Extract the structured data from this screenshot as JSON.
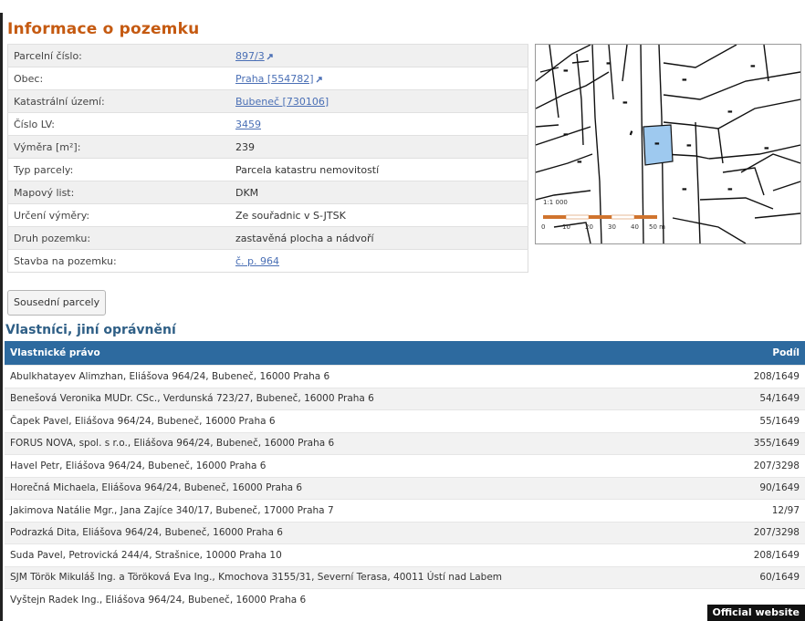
{
  "parcel_info": {
    "title": "Informace o pozemku",
    "rows": [
      {
        "label": "Parcelní číslo:",
        "value": "897/3",
        "link": true,
        "ext": true
      },
      {
        "label": "Obec:",
        "value": "Praha [554782]",
        "link": true,
        "ext": true
      },
      {
        "label": "Katastrální území:",
        "value": "Bubeneč [730106]",
        "link": true,
        "ext": false
      },
      {
        "label": "Číslo LV:",
        "value": "3459",
        "link": true,
        "ext": false
      },
      {
        "label": "Výměra [m²]:",
        "value": "239",
        "link": false,
        "ext": false
      },
      {
        "label": "Typ parcely:",
        "value": "Parcela katastru nemovitostí",
        "link": false,
        "ext": false
      },
      {
        "label": "Mapový list:",
        "value": "DKM",
        "link": false,
        "ext": false
      },
      {
        "label": "Určení výměry:",
        "value": "Ze souřadnic v S-JTSK",
        "link": false,
        "ext": false
      },
      {
        "label": "Druh pozemku:",
        "value": "zastavěná plocha a nádvoří",
        "link": false,
        "ext": false
      },
      {
        "label": "Stavba na pozemku:",
        "value": "č. p. 964",
        "link": true,
        "ext": false
      }
    ]
  },
  "map": {
    "scale_label": "1:1 000",
    "scale_ticks": [
      "0",
      "10",
      "20",
      "30",
      "40",
      "50 m"
    ],
    "highlight_color": "#9ec9ef"
  },
  "neighbors_button": "Sousední parcely",
  "owners": {
    "title": "Vlastníci, jiní oprávnění",
    "header": {
      "name": "Vlastnické právo",
      "share": "Podíl"
    },
    "rows": [
      {
        "name": "Abulkhatayev Alimzhan, Eliášova 964/24, Bubeneč, 16000 Praha 6",
        "share": "208/1649"
      },
      {
        "name": "Benešová Veronika MUDr. CSc., Verdunská 723/27, Bubeneč, 16000 Praha 6",
        "share": "54/1649"
      },
      {
        "name": "Čapek Pavel, Eliášova 964/24, Bubeneč, 16000 Praha 6",
        "share": "55/1649"
      },
      {
        "name": "FORUS NOVA, spol. s r.o., Eliášova 964/24, Bubeneč, 16000 Praha 6",
        "share": "355/1649"
      },
      {
        "name": "Havel Petr, Eliášova 964/24, Bubeneč, 16000 Praha 6",
        "share": "207/3298"
      },
      {
        "name": "Horečná Michaela, Eliášova 964/24, Bubeneč, 16000 Praha 6",
        "share": "90/1649"
      },
      {
        "name": "Jakimova Natálie Mgr., Jana Zajíce 340/17, Bubeneč, 17000 Praha 7",
        "share": "12/97"
      },
      {
        "name": "Podrazká Dita, Eliášova 964/24, Bubeneč, 16000 Praha 6",
        "share": "207/3298"
      },
      {
        "name": "Suda Pavel, Petrovická 244/4, Strašnice, 10000 Praha 10",
        "share": "208/1649"
      },
      {
        "name": "SJM Török Mikuláš Ing. a Töröková Eva Ing., Kmochova 3155/31, Severní Terasa, 40011 Ústí nad Labem",
        "share": "60/1649"
      },
      {
        "name": "Vyštejn Radek Ing., Eliášova 964/24, Bubeneč, 16000 Praha 6",
        "share": ""
      }
    ]
  },
  "badge": "Official website"
}
